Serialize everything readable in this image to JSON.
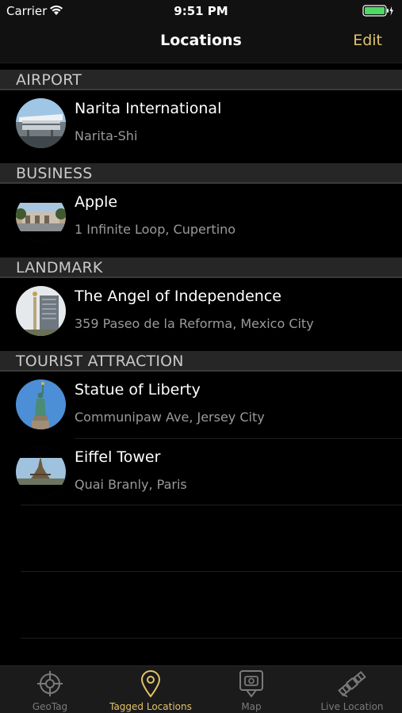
{
  "status_bar": {
    "carrier": "Carrier",
    "time": "9:51 PM"
  },
  "nav": {
    "title": "Locations",
    "edit_label": "Edit"
  },
  "sections": [
    {
      "header": "AIRPORT",
      "items": [
        {
          "title": "Narita International",
          "subtitle": "Narita-Shi",
          "thumb_icon": "airport-photo"
        }
      ]
    },
    {
      "header": "BUSINESS",
      "items": [
        {
          "title": "Apple",
          "subtitle": "1 Infinite Loop, Cupertino",
          "thumb_icon": "apple-campus-photo"
        }
      ]
    },
    {
      "header": "LANDMARK",
      "items": [
        {
          "title": "The Angel of Independence",
          "subtitle": "359 Paseo de la Reforma, Mexico City",
          "thumb_icon": "angel-monument-photo"
        }
      ]
    },
    {
      "header": "TOURIST ATTRACTION",
      "items": [
        {
          "title": "Statue of Liberty",
          "subtitle": "Communipaw Ave, Jersey City",
          "thumb_icon": "statue-of-liberty-photo"
        },
        {
          "title": "Eiffel Tower",
          "subtitle": "Quai Branly, Paris",
          "thumb_icon": "eiffel-tower-photo"
        }
      ]
    }
  ],
  "tabs": [
    {
      "label": "GeoTag",
      "icon": "crosshair-icon",
      "active": false
    },
    {
      "label": "Tagged Locations",
      "icon": "location-pin-icon",
      "active": true
    },
    {
      "label": "Map",
      "icon": "map-icon",
      "active": false
    },
    {
      "label": "Live Location",
      "icon": "satellite-icon",
      "active": false
    }
  ],
  "colors": {
    "accent": "#e3c46a",
    "background": "#000000",
    "section_header": "#262626",
    "subtitle": "#9a9a9a"
  }
}
